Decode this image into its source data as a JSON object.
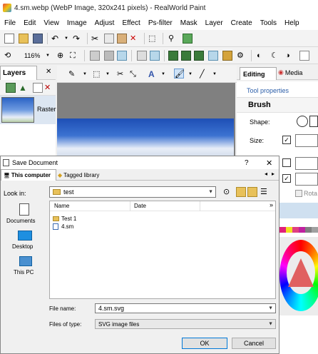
{
  "app": {
    "title": "4.sm.webp (WebP Image, 320x241 pixels) - RealWorld Paint"
  },
  "menu": [
    "File",
    "Edit",
    "View",
    "Image",
    "Adjust",
    "Effect",
    "Ps-filter",
    "Mask",
    "Layer",
    "Create",
    "Tools",
    "Help"
  ],
  "toolbar2": {
    "zoom": "116%"
  },
  "layers_panel": {
    "tab": "Layers",
    "close": "✕",
    "layer_name": "Raster"
  },
  "right_panel": {
    "tab_editing": "Editing",
    "tab_media": "Media",
    "tool_properties": "Tool properties",
    "tool_name": "Brush",
    "shape_label": "Shape:",
    "size_label": "Size:",
    "rotate_label": "Rota"
  },
  "dialog": {
    "title": "Save Document",
    "help": "?",
    "close": "✕",
    "tab_this_computer": "This computer",
    "tab_tagged_library": "Tagged library",
    "look_in_label": "Look in:",
    "look_in_value": "test",
    "places": [
      {
        "label": "Documents",
        "icon": "document-icon"
      },
      {
        "label": "Desktop",
        "icon": "desktop-icon"
      },
      {
        "label": "This PC",
        "icon": "computer-icon"
      }
    ],
    "columns": {
      "name": "Name",
      "date": "Date"
    },
    "files": [
      {
        "name": "Test 1",
        "type": "folder"
      },
      {
        "name": "4.sm",
        "type": "file"
      }
    ],
    "file_name_label": "File name:",
    "file_name_value": "4.sm.svg",
    "file_type_label": "Files of type:",
    "file_type_value": "SVG image files",
    "ok": "OK",
    "cancel": "Cancel"
  }
}
